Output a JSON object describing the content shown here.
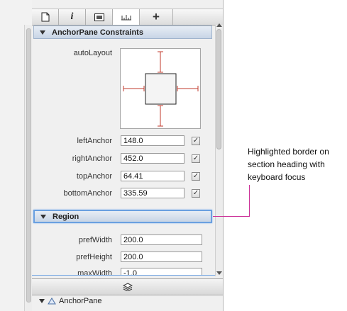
{
  "tabs": [
    {
      "icon": "page-icon"
    },
    {
      "icon": "info-icon",
      "label": "i"
    },
    {
      "icon": "layout-icon"
    },
    {
      "icon": "ruler-icon"
    },
    {
      "icon": "plus-icon",
      "label": "+"
    }
  ],
  "anchor_section": {
    "title": "AnchorPane Constraints",
    "autolayout_label": "autoLayout",
    "rows": [
      {
        "label": "leftAnchor",
        "value": "148.0",
        "checked": "✓"
      },
      {
        "label": "rightAnchor",
        "value": "452.0",
        "checked": "✓"
      },
      {
        "label": "topAnchor",
        "value": "64.41",
        "checked": "✓"
      },
      {
        "label": "bottomAnchor",
        "value": "335.59",
        "checked": "✓"
      }
    ]
  },
  "region_section": {
    "title": "Region",
    "rows": [
      {
        "label": "prefWidth",
        "value": "200.0"
      },
      {
        "label": "prefHeight",
        "value": "200.0"
      },
      {
        "label": "maxWidth",
        "value": "-1.0"
      }
    ]
  },
  "hierarchy": {
    "root_label": "AnchorPane"
  },
  "callout": {
    "text": "Highlighted border on section heading with keyboard focus",
    "color": "#cc3399"
  },
  "colors": {
    "anchor_line": "#c0392b",
    "focus_border": "#6aa0e0"
  }
}
